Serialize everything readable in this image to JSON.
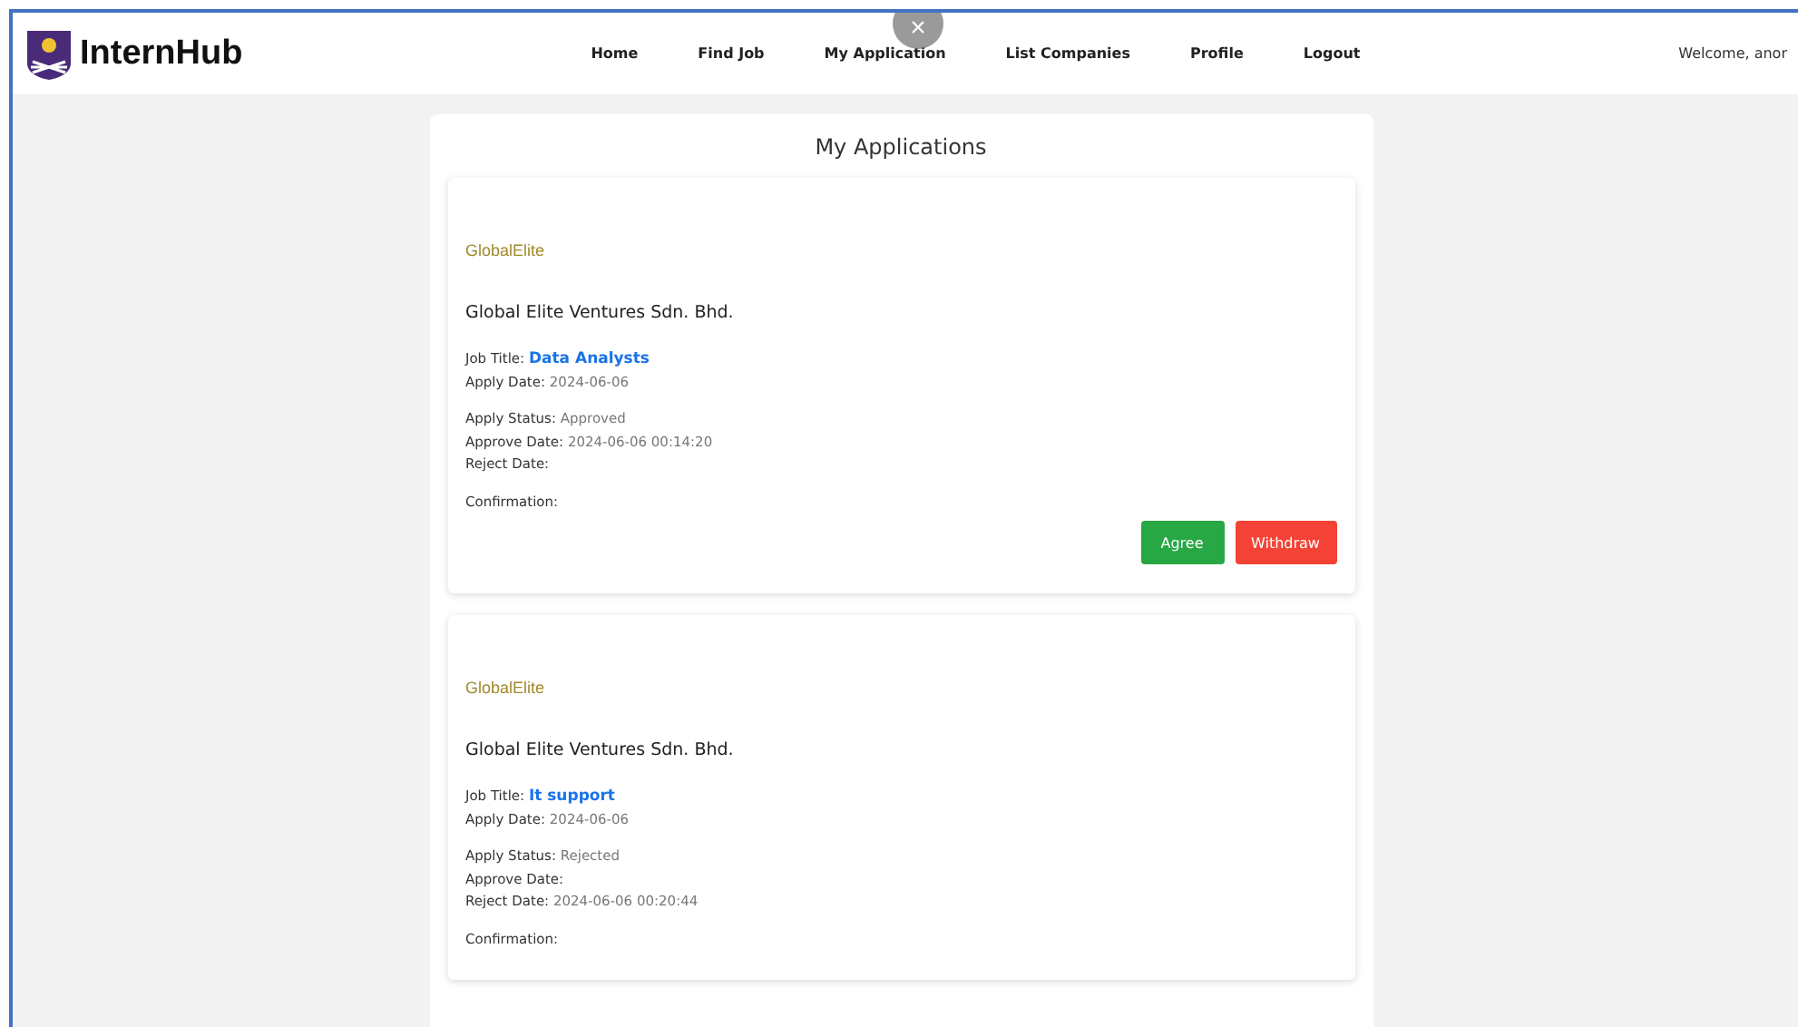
{
  "brand": {
    "name": "InternHub"
  },
  "nav": [
    {
      "label": "Home"
    },
    {
      "label": "Find Job"
    },
    {
      "label": "My Application"
    },
    {
      "label": "List Companies"
    },
    {
      "label": "Profile"
    },
    {
      "label": "Logout"
    }
  ],
  "welcome": "Welcome, anor",
  "close_button": {
    "label": "×"
  },
  "page_title": "My Applications",
  "applications": [
    {
      "logo_text": "GlobalElite",
      "company": "Global Elite Ventures Sdn. Bhd.",
      "job": {
        "label": "Job Title:",
        "value": "Data Analysts"
      },
      "groups": [
        [
          {
            "label": "Apply Date:",
            "value": "2024-06-06"
          }
        ],
        [
          {
            "label": "Apply Status:",
            "value": "Approved"
          },
          {
            "label": "Approve Date:",
            "value": "2024-06-06 00:14:20"
          },
          {
            "label": "Reject Date:"
          }
        ],
        [
          {
            "label": "Confirmation:"
          }
        ]
      ],
      "buttons": [
        {
          "label": "Agree",
          "kind": "success"
        },
        {
          "label": "Withdraw",
          "kind": "danger"
        }
      ]
    },
    {
      "logo_text": "GlobalElite",
      "company": "Global Elite Ventures Sdn. Bhd.",
      "job": {
        "label": "Job Title:",
        "value": "It support"
      },
      "groups": [
        [
          {
            "label": "Apply Date:",
            "value": "2024-06-06"
          }
        ],
        [
          {
            "label": "Apply Status:",
            "value": "Rejected"
          },
          {
            "label": "Approve Date:"
          },
          {
            "label": "Reject Date:",
            "value": "2024-06-06 00:20:44"
          }
        ],
        [
          {
            "label": "Confirmation:"
          }
        ]
      ]
    }
  ]
}
